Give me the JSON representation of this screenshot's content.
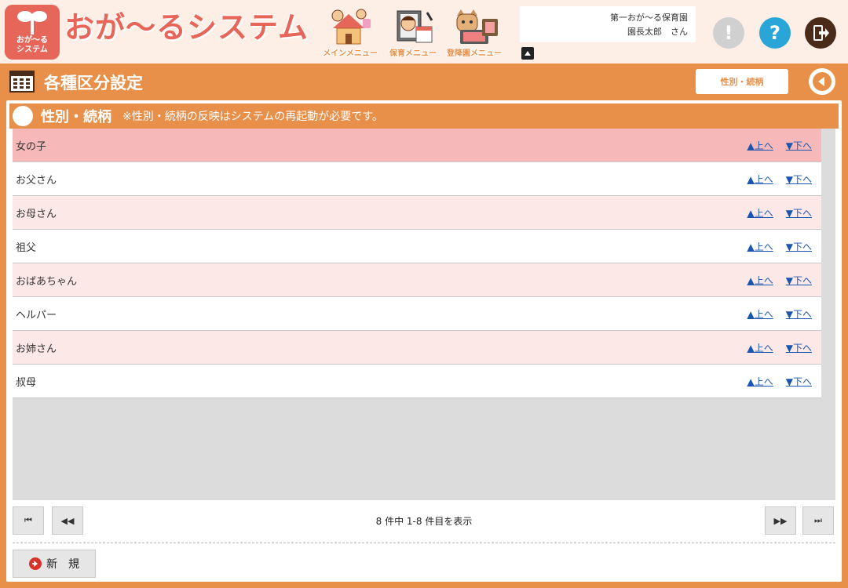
{
  "header": {
    "logo_text_line1": "おが〜る",
    "logo_text_line2": "システム",
    "app_title": "おが〜るシステム",
    "nav": [
      {
        "label": "メインメニュー",
        "icon": "house-family-icon"
      },
      {
        "label": "保育メニュー",
        "icon": "childcare-calendar-icon"
      },
      {
        "label": "登降園メニュー",
        "icon": "cat-tablet-icon"
      }
    ],
    "user": {
      "facility": "第一おが〜る保育園",
      "name": "園長太郎　さん"
    },
    "icons": {
      "alert": "!",
      "help": "?",
      "logout": "logout-icon"
    }
  },
  "titlebar": {
    "page_title": "各種区分設定",
    "tab_label": "性別・続柄"
  },
  "section": {
    "title": "性別・続柄",
    "note": "※性別・続柄の反映はシステムの再起動が必要です。"
  },
  "rows": [
    {
      "label": "女の子",
      "up": "▲上へ",
      "down": "▼下へ",
      "highlight": true
    },
    {
      "label": "お父さん",
      "up": "▲上へ",
      "down": "▼下へ"
    },
    {
      "label": "お母さん",
      "up": "▲上へ",
      "down": "▼下へ"
    },
    {
      "label": "祖父",
      "up": "▲上へ",
      "down": "▼下へ"
    },
    {
      "label": "おばあちゃん",
      "up": "▲上へ",
      "down": "▼下へ"
    },
    {
      "label": "ヘルパー",
      "up": "▲上へ",
      "down": "▼下へ"
    },
    {
      "label": "お姉さん",
      "up": "▲上へ",
      "down": "▼下へ"
    },
    {
      "label": "叔母",
      "up": "▲上へ",
      "down": "▼下へ"
    }
  ],
  "pager": {
    "info": "8 件中 1-8 件目を表示",
    "first": "⏮",
    "prev": "◀◀",
    "next": "▶▶",
    "last": "⏭"
  },
  "new_button": {
    "label": "新　規"
  },
  "colors": {
    "accent": "#e8904a",
    "brand": "#e6665a",
    "row_selected": "#f6b8b8",
    "row_alt": "#fde8e8",
    "row_plain": "#ffffff",
    "link": "#1a56b0",
    "help": "#2aa5d8"
  }
}
